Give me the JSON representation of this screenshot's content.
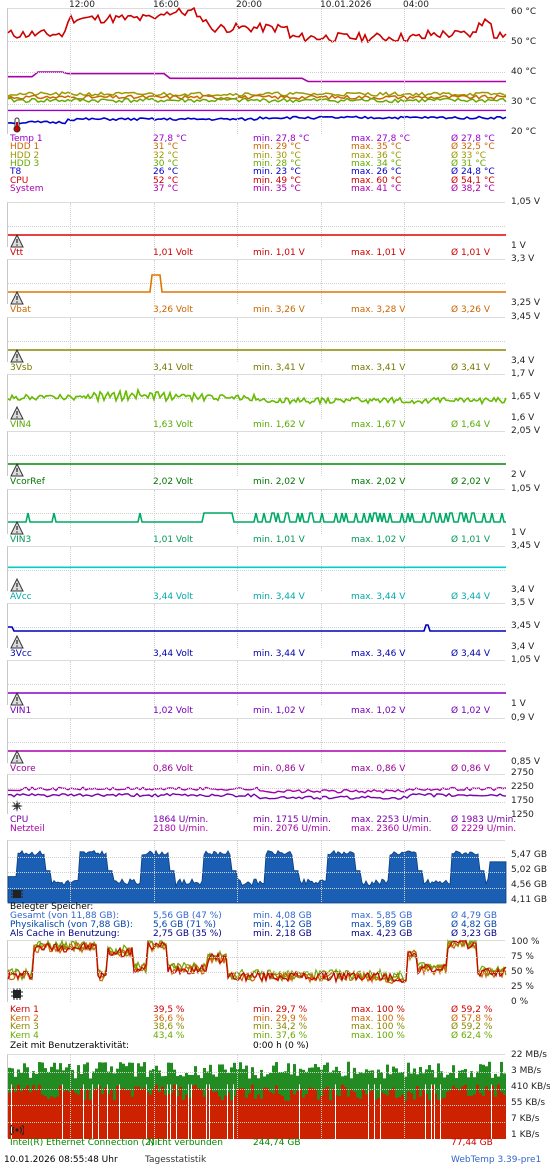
{
  "time_axis": [
    "12:00",
    "16:00",
    "20:00",
    "10.01.2026",
    "04:00"
  ],
  "temperature": {
    "ticks": [
      "60 °C",
      "50 °C",
      "40 °C",
      "30 °C",
      "20 °C"
    ],
    "colors": {
      "temp1": "#9900cc",
      "hdd1": "#cc6600",
      "hdd2": "#999900",
      "hdd3": "#66aa00",
      "t8": "#0000cc",
      "cpu": "#cc0000",
      "system": "#aa00aa"
    },
    "rows": [
      {
        "name": "Temp 1",
        "value": "27,8 °C",
        "min": "min. 27,8 °C",
        "max": "max. 27,8 °C",
        "avg": "Ø 27,8 °C",
        "color": "#9900cc"
      },
      {
        "name": "HDD 1",
        "value": "31 °C",
        "min": "min. 29 °C",
        "max": "max. 35 °C",
        "avg": "Ø 32,5 °C",
        "color": "#cc6600"
      },
      {
        "name": "HDD 2",
        "value": "32 °C",
        "min": "min. 30 °C",
        "max": "max. 36 °C",
        "avg": "Ø 33 °C",
        "color": "#999900"
      },
      {
        "name": "HDD 3",
        "value": "30 °C",
        "min": "min. 28 °C",
        "max": "max. 34 °C",
        "avg": "Ø 31 °C",
        "color": "#66aa00"
      },
      {
        "name": "T8",
        "value": "26 °C",
        "min": "min. 23 °C",
        "max": "max. 26 °C",
        "avg": "Ø 24,8 °C",
        "color": "#0000cc"
      },
      {
        "name": "CPU",
        "value": "52 °C",
        "min": "min. 49 °C",
        "max": "max. 60 °C",
        "avg": "Ø 54,1 °C",
        "color": "#cc0000"
      },
      {
        "name": "System",
        "value": "37 °C",
        "min": "min. 35 °C",
        "max": "max. 41 °C",
        "avg": "Ø 38,2 °C",
        "color": "#aa00aa"
      }
    ]
  },
  "voltages": [
    {
      "key": "vtt",
      "name": "Vtt",
      "value": "1,01 Volt",
      "min": "min. 1,01 V",
      "max": "max. 1,01 V",
      "avg": "Ø 1,01 V",
      "top": "1,05 V",
      "bottom": "1 V",
      "color": "#dd0000",
      "label_color": "#cc0000"
    },
    {
      "key": "vbat",
      "name": "Vbat",
      "value": "3,26 Volt",
      "min": "min. 3,26 V",
      "max": "max. 3,28 V",
      "avg": "Ø 3,26 V",
      "top": "3,3 V",
      "bottom": "3,25 V",
      "color": "#dd7700",
      "label_color": "#cc6600"
    },
    {
      "key": "3vsb",
      "name": "3Vsb",
      "value": "3,41 Volt",
      "min": "min. 3,41 V",
      "max": "max. 3,41 V",
      "avg": "Ø 3,41 V",
      "top": "3,45 V",
      "bottom": "3,4 V",
      "color": "#888800",
      "label_color": "#777700"
    },
    {
      "key": "vin4",
      "name": "VIN4",
      "value": "1,63 Volt",
      "min": "min. 1,62 V",
      "max": "max. 1,67 V",
      "avg": "Ø 1,64 V",
      "top": "1,7 V",
      "bottom": "1,6 V",
      "mid": "1,65 V",
      "color": "#66bb00",
      "label_color": "#55aa00"
    },
    {
      "key": "vcorref",
      "name": "VcorRef",
      "value": "2,02 Volt",
      "min": "min. 2,02 V",
      "max": "max. 2,02 V",
      "avg": "Ø 2,02 V",
      "top": "2,05 V",
      "bottom": "2 V",
      "color": "#008800",
      "label_color": "#007700"
    },
    {
      "key": "vin3",
      "name": "VIN3",
      "value": "1,01 Volt",
      "min": "min. 1,01 V",
      "max": "max. 1,02 V",
      "avg": "Ø 1,01 V",
      "top": "1,05 V",
      "bottom": "1 V",
      "color": "#00aa66",
      "label_color": "#009955"
    },
    {
      "key": "avcc",
      "name": "AVcc",
      "value": "3,44 Volt",
      "min": "min. 3,44 V",
      "max": "max. 3,44 V",
      "avg": "Ø 3,44 V",
      "top": "3,45 V",
      "bottom": "3,4 V",
      "color": "#00cccc",
      "label_color": "#00aaaa"
    },
    {
      "key": "3vcc",
      "name": "3Vcc",
      "value": "3,44 Volt",
      "min": "min. 3,44 V",
      "max": "max. 3,46 V",
      "avg": "Ø 3,44 V",
      "top": "3,5 V",
      "bottom": "3,4 V",
      "mid": "3,45 V",
      "color": "#0000bb",
      "label_color": "#0000aa"
    },
    {
      "key": "vin1",
      "name": "VIN1",
      "value": "1,02 Volt",
      "min": "min. 1,02 V",
      "max": "max. 1,02 V",
      "avg": "Ø 1,02 V",
      "top": "1,05 V",
      "bottom": "1 V",
      "color": "#8800cc",
      "label_color": "#7700bb"
    },
    {
      "key": "vcore",
      "name": "Vcore",
      "value": "0,86 Volt",
      "min": "min. 0,86 V",
      "max": "max. 0,86 V",
      "avg": "Ø 0,86 V",
      "top": "0,9 V",
      "bottom": "0,85 V",
      "color": "#aa00aa",
      "label_color": "#990099"
    }
  ],
  "fans": {
    "ticks": [
      "2750",
      "2250",
      "1750",
      "1250"
    ],
    "rows": [
      {
        "name": "CPU",
        "value": "1864 U/min.",
        "min": "min. 1715 U/min.",
        "max": "max. 2253 U/min.",
        "avg": "Ø 1983 U/min.",
        "color": "#7700aa"
      },
      {
        "name": "Netzteil",
        "value": "2180 U/min.",
        "min": "min. 2076 U/min.",
        "max": "max. 2360 U/min.",
        "avg": "Ø 2229 U/min.",
        "color": "#aa00aa"
      }
    ]
  },
  "memory": {
    "ticks": [
      "5,47 GB",
      "5,02 GB",
      "4,56 GB",
      "4,11 GB"
    ],
    "header": "Belegter Speicher:",
    "rows": [
      {
        "name": "Gesamt (von 11,88 GB):",
        "value": "5,56 GB (47 %)",
        "min": "min. 4,08 GB",
        "max": "max. 5,85 GB",
        "avg": "Ø 4,79 GB",
        "color": "#3366cc"
      },
      {
        "name": "Physikalisch (von 7,88 GB):",
        "value": "5,6 GB (71 %)",
        "min": "min. 4,12 GB",
        "max": "max. 5,89 GB",
        "avg": "Ø 4,82 GB",
        "color": "#0044aa"
      },
      {
        "name": "Als Cache in Benutzung:",
        "value": "2,75 GB (35 %)",
        "min": "min. 2,18 GB",
        "max": "max. 4,23 GB",
        "avg": "Ø 3,23 GB",
        "color": "#000088"
      }
    ]
  },
  "cpu_load": {
    "ticks": [
      "100 %",
      "75 %",
      "50 %",
      "25 %",
      "0 %"
    ],
    "rows": [
      {
        "name": "Kern 1",
        "value": "39,5 %",
        "min": "min. 29,7 %",
        "max": "max. 100 %",
        "avg": "Ø 59,2 %",
        "color": "#cc0000"
      },
      {
        "name": "Kern 2",
        "value": "36,6 %",
        "min": "min. 29,9 %",
        "max": "max. 100 %",
        "avg": "Ø 57,8 %",
        "color": "#cc6600"
      },
      {
        "name": "Kern 3",
        "value": "38,6 %",
        "min": "min. 34,2 %",
        "max": "max. 100 %",
        "avg": "Ø 59,2 %",
        "color": "#888800"
      },
      {
        "name": "Kern 4",
        "value": "43,4 %",
        "min": "min. 37,6 %",
        "max": "max. 100 %",
        "avg": "Ø 62,4 %",
        "color": "#66aa00"
      }
    ],
    "idle_label": "Zeit mit Benutzeraktivität:",
    "idle_value": "0:00 h (0 %)"
  },
  "network": {
    "ticks": [
      "22 MB/s",
      "3 MB/s",
      "410 KB/s",
      "55 KB/s",
      "7 KB/s",
      "1 KB/s"
    ],
    "adapter": "Intel(R) Ethernet Connection (2) I",
    "status": "Nicht verbunden",
    "received": "244,74 GB",
    "sent": "77,44 GB"
  },
  "footer": {
    "datetime": "10.01.2026 08:55:48 Uhr",
    "link": "Tagesstatistik",
    "app": "WebTemp 3.39-pre1"
  }
}
